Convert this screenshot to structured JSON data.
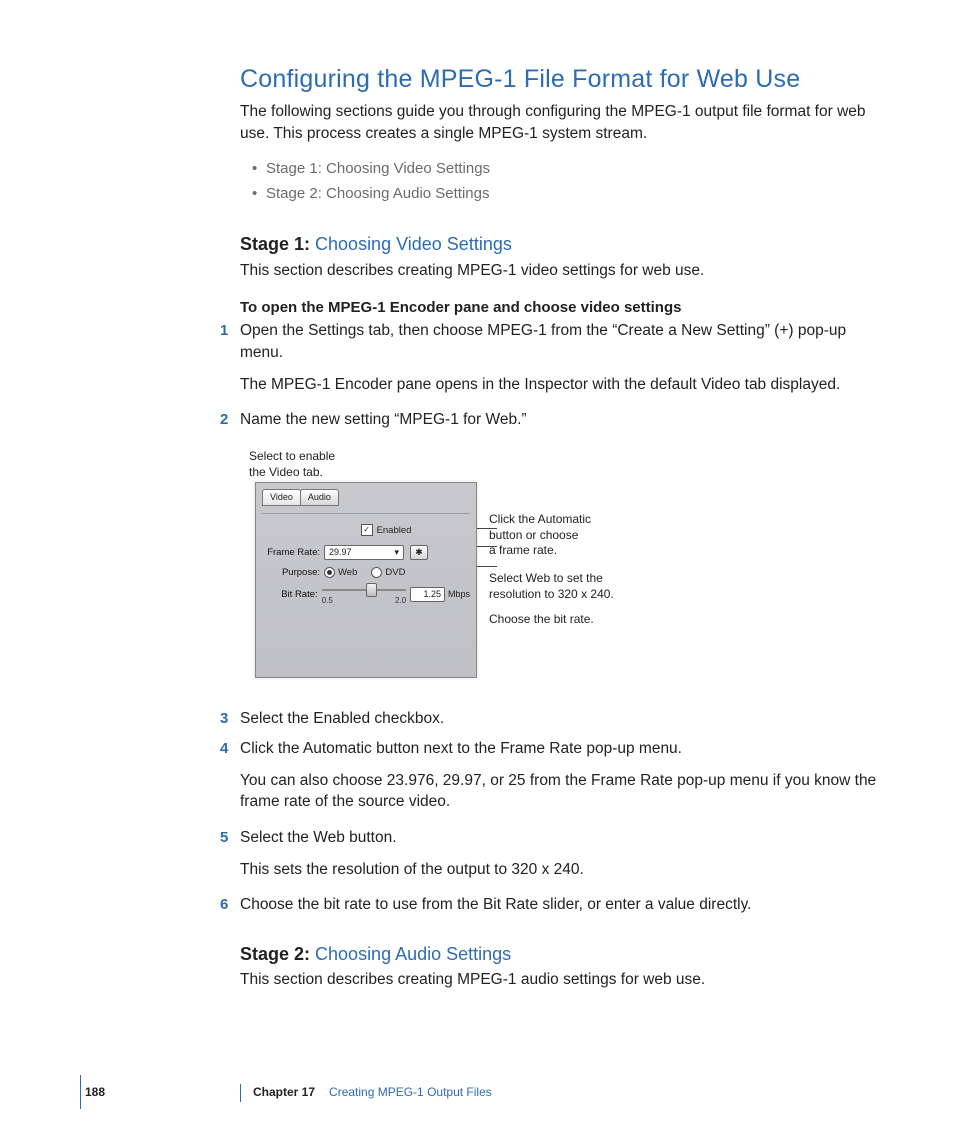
{
  "heading": "Configuring the MPEG-1 File Format for Web Use",
  "intro": "The following sections guide you through configuring the MPEG-1 output file format for web use. This process creates a single MPEG-1 system stream.",
  "stages_list": [
    "Stage 1: Choosing Video Settings",
    "Stage 2: Choosing Audio Settings"
  ],
  "stage1": {
    "prefix": "Stage 1: ",
    "title": "Choosing Video Settings",
    "desc": "This section describes creating MPEG-1 video settings for web use.",
    "lead": "To open the MPEG-1 Encoder pane and choose video settings",
    "steps": [
      {
        "num": "1",
        "text": "Open the Settings tab, then choose MPEG-1 from the “Create a New Setting” (+) pop-up menu.",
        "follow": "The MPEG-1 Encoder pane opens in the Inspector with the default Video tab displayed."
      },
      {
        "num": "2",
        "text": "Name the new setting “MPEG-1 for Web.”"
      }
    ],
    "steps_after": [
      {
        "num": "3",
        "text": "Select the Enabled checkbox."
      },
      {
        "num": "4",
        "text": "Click the Automatic button next to the Frame Rate pop-up menu.",
        "follow": "You can also choose 23.976, 29.97, or 25 from the Frame Rate pop-up menu if you know the frame rate of the source video."
      },
      {
        "num": "5",
        "text": "Select the Web button.",
        "follow": "This sets the resolution of the output to 320 x 240."
      },
      {
        "num": "6",
        "text": "Choose the bit rate to use from the Bit Rate slider, or enter a value directly."
      }
    ]
  },
  "mock": {
    "callout_top_l1": "Select to enable",
    "callout_top_l2": "the Video tab.",
    "tabs": {
      "video": "Video",
      "audio": "Audio"
    },
    "enabled_label": "Enabled",
    "frame_rate_label": "Frame Rate:",
    "frame_rate_value": "29.97",
    "auto_icon": "✱",
    "purpose_label": "Purpose:",
    "purpose_web": "Web",
    "purpose_dvd": "DVD",
    "bitrate_label": "Bit Rate:",
    "bitrate_value": "1.25",
    "bitrate_unit": "Mbps",
    "bitrate_min": "0.5",
    "bitrate_max": "2.0",
    "callouts": {
      "auto_l1": "Click the Automatic",
      "auto_l2": "button or choose",
      "auto_l3": "a frame rate.",
      "web_l1": "Select Web to set the",
      "web_l2": "resolution to 320 x 240.",
      "bitrate": "Choose the bit rate."
    }
  },
  "stage2": {
    "prefix": "Stage 2: ",
    "title": "Choosing Audio Settings",
    "desc": "This section describes creating MPEG-1 audio settings for web use."
  },
  "footer": {
    "page": "188",
    "chapter": "Chapter 17",
    "title": "Creating MPEG-1 Output Files"
  }
}
